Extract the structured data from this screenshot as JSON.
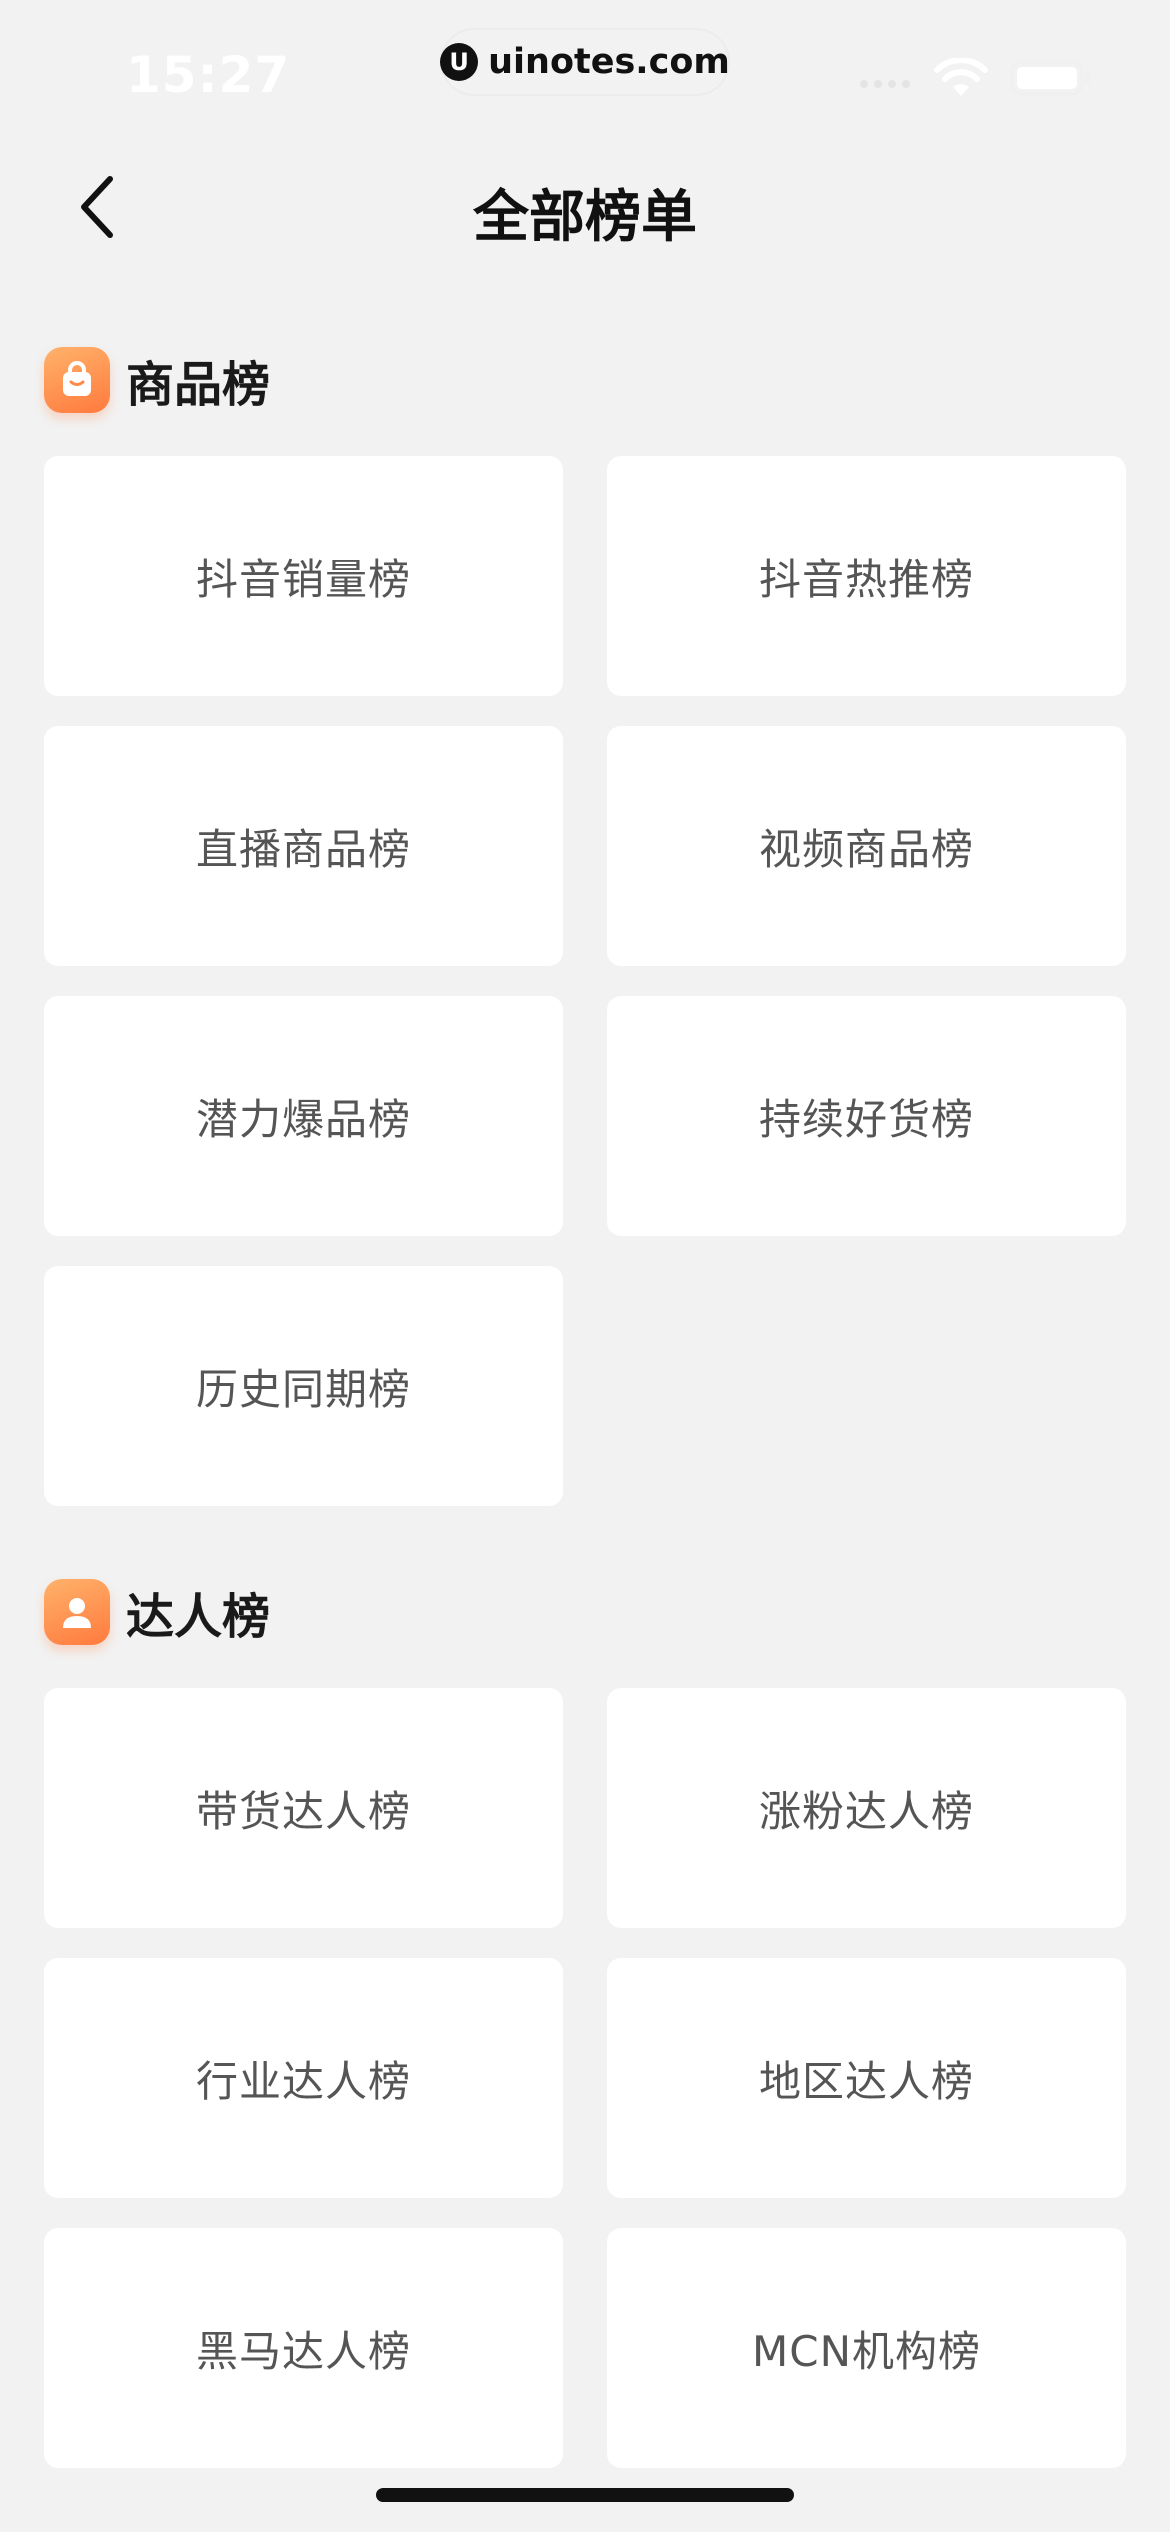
{
  "status_bar": {
    "time": "15:27",
    "url_logo": "U",
    "url": "uinotes.com"
  },
  "nav": {
    "back_icon": "chevron-left-icon",
    "title": "全部榜单"
  },
  "sections": [
    {
      "title": "商品榜",
      "icon": "shopping-bag-icon",
      "items": [
        "抖音销量榜",
        "抖音热推榜",
        "直播商品榜",
        "视频商品榜",
        "潜力爆品榜",
        "持续好货榜",
        "历史同期榜"
      ]
    },
    {
      "title": "达人榜",
      "icon": "person-icon",
      "items": [
        "带货达人榜",
        "涨粉达人榜",
        "行业达人榜",
        "地区达人榜",
        "黑马达人榜",
        "MCN机构榜"
      ]
    }
  ],
  "colors": {
    "background": "#f2f2f2",
    "card": "#ffffff",
    "accent": "#ff8a47"
  }
}
